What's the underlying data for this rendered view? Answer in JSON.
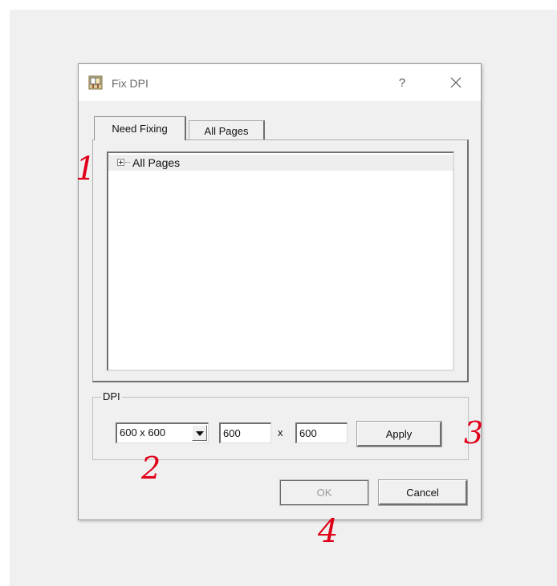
{
  "window": {
    "title": "Fix DPI",
    "help_glyph": "?",
    "icon": "app-icon"
  },
  "tabs": [
    {
      "label": "Need Fixing",
      "selected": true
    },
    {
      "label": "All Pages",
      "selected": false
    }
  ],
  "tree": {
    "items": [
      {
        "label": "All Pages",
        "expander": "+"
      }
    ]
  },
  "dpi_group": {
    "legend": "DPI",
    "preset": {
      "value": "600 x 600"
    },
    "width_value": "600",
    "separator": "x",
    "height_value": "600",
    "apply_label": "Apply"
  },
  "footer": {
    "ok_label": "OK",
    "ok_enabled": false,
    "cancel_label": "Cancel"
  },
  "annotations": [
    "1",
    "2",
    "3",
    "4"
  ],
  "colors": {
    "annotation": "#e0001a",
    "dialog_bg": "#f0f0f0",
    "titlebar_bg": "#ffffff"
  }
}
